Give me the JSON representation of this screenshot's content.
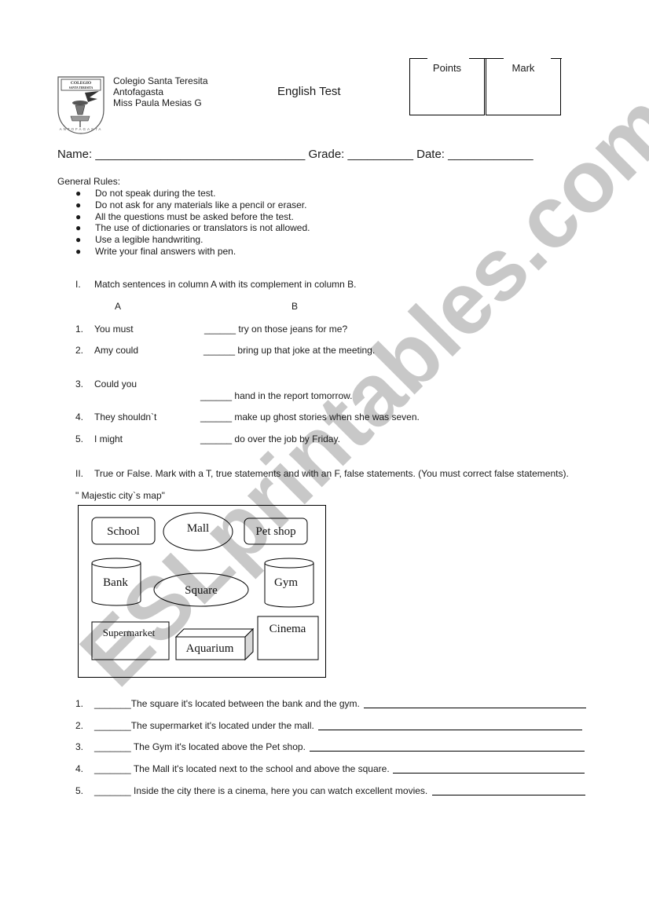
{
  "header": {
    "logo": {
      "icon": "school-crest-icon",
      "top_text": "COLEGIO",
      "sub_text": "SANTA TERESITA",
      "arc_text": "ANTOFAGASTA"
    },
    "school_name": "Colegio Santa Teresita",
    "city": "Antofagasta",
    "teacher": "Miss Paula Mesias G",
    "title": "English Test",
    "score_box": {
      "points_label": "Points",
      "mark_label": "Mark"
    }
  },
  "student_fields": {
    "name_label": "Name:",
    "name_blank": "________________________________",
    "grade_label": "Grade:",
    "grade_blank": "__________",
    "date_label": "Date:",
    "date_blank": "_____________"
  },
  "rules": {
    "title": "General Rules:",
    "bullet_icon": "●",
    "items": [
      "Do not speak during the test.",
      "Do not ask for any materials like a pencil or eraser.",
      "All the questions must be asked before the test.",
      "The use of dictionaries or translators is not allowed.",
      "Use a legible handwriting.",
      "Write your final answers with pen."
    ]
  },
  "section1": {
    "numeral": "I.",
    "instruction": "Match sentences in column A with its complement in column B.",
    "col_a_label": "A",
    "col_b_label": "B",
    "blank": "______",
    "items": [
      {
        "num": "1.",
        "a": "You must",
        "b": "try on those jeans for me?"
      },
      {
        "num": "2.",
        "a": "Amy could",
        "b": "bring up that joke at the meeting."
      },
      {
        "num": "3.",
        "a": "Could you",
        "b": "hand in the report tomorrow."
      },
      {
        "num": "4.",
        "a": "They shouldn`t",
        "b": "make up ghost stories when she was seven."
      },
      {
        "num": "5.",
        "a": "I might",
        "b": "do over the job by Friday."
      }
    ]
  },
  "section2": {
    "numeral": "II.",
    "instruction": "True or False. Mark with a T, true statements and with an F, false statements. (You must correct false statements).",
    "map_caption": "\"   Majestic city`s map\"",
    "map_places": {
      "school": "School",
      "mall": "Mall",
      "pet_shop": "Pet shop",
      "bank": "Bank",
      "square": "Square",
      "gym": "Gym",
      "supermarket": "Supermarket",
      "aquarium": "Aquarium",
      "cinema": "Cinema"
    },
    "blank": "_______",
    "statements": [
      {
        "num": "1.",
        "text": "The square it's located between the bank and the gym."
      },
      {
        "num": "2.",
        "text": "The supermarket it's located under the mall."
      },
      {
        "num": "3.",
        "text": " The Gym it's located above the Pet shop."
      },
      {
        "num": "4.",
        "text": " The Mall it's located next to the school and above the square."
      },
      {
        "num": "5.",
        "text": " Inside the city there is a cinema, here you can watch excellent movies."
      }
    ]
  },
  "watermark": {
    "text": "ESLprintables.com",
    "color": "#c8c8c8"
  }
}
